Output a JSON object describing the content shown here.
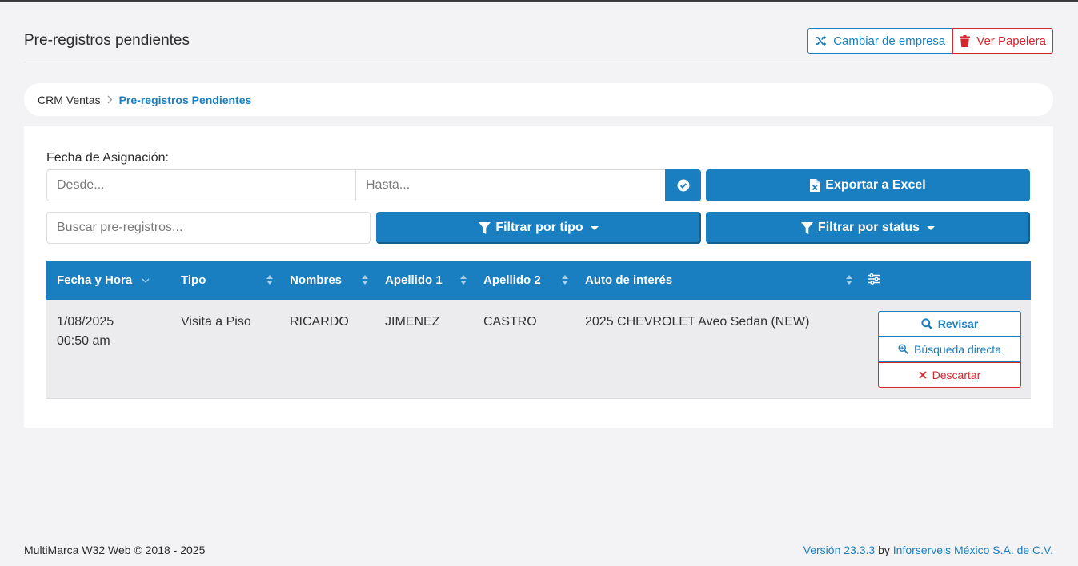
{
  "header": {
    "title": "Pre-registros pendientes",
    "change_company": "Cambiar de empresa",
    "trash": "Ver Papelera"
  },
  "breadcrumb": {
    "parent": "CRM Ventas",
    "current": "Pre-registros Pendientes"
  },
  "filters": {
    "fecha_label": "Fecha de Asignación:",
    "desde_placeholder": "Desde...",
    "hasta_placeholder": "Hasta...",
    "buscar_placeholder": "Buscar pre-registros...",
    "export_label": "Exportar a Excel",
    "tipo_label": "Filtrar por tipo",
    "status_label": "Filtrar por status"
  },
  "table": {
    "columns": [
      "Fecha y Hora",
      "Tipo",
      "Nombres",
      "Apellido 1",
      "Apellido 2",
      "Auto de interés"
    ],
    "rows": [
      {
        "fecha": "1/08/2025",
        "hora": "00:50 am",
        "tipo": "Visita a Piso",
        "nombres": "RICARDO",
        "apellido1": "JIMENEZ",
        "apellido2": "CASTRO",
        "auto": "2025 CHEVROLET Aveo Sedan (NEW)",
        "actions": {
          "revisar": "Revisar",
          "busqueda": "Búsqueda directa",
          "descartar": "Descartar"
        }
      }
    ]
  },
  "footer": {
    "copyright": "MultiMarca W32 Web © 2018 - 2025",
    "version": "Versión 23.3.3",
    "by": " by ",
    "company": "Inforserveis México S.A. de C.V."
  },
  "colors": {
    "primary": "#1a7fc1",
    "danger": "#d4272e",
    "background": "#f3f3f6"
  },
  "icons": [
    "shuffle-icon",
    "trash-icon",
    "chevron-right-icon",
    "check-circle-icon",
    "excel-file-icon",
    "filter-icon",
    "caret-down-icon",
    "sort-icon",
    "chevron-down-icon",
    "column-settings-icon",
    "search-icon",
    "zoom-search-icon",
    "x-icon"
  ]
}
